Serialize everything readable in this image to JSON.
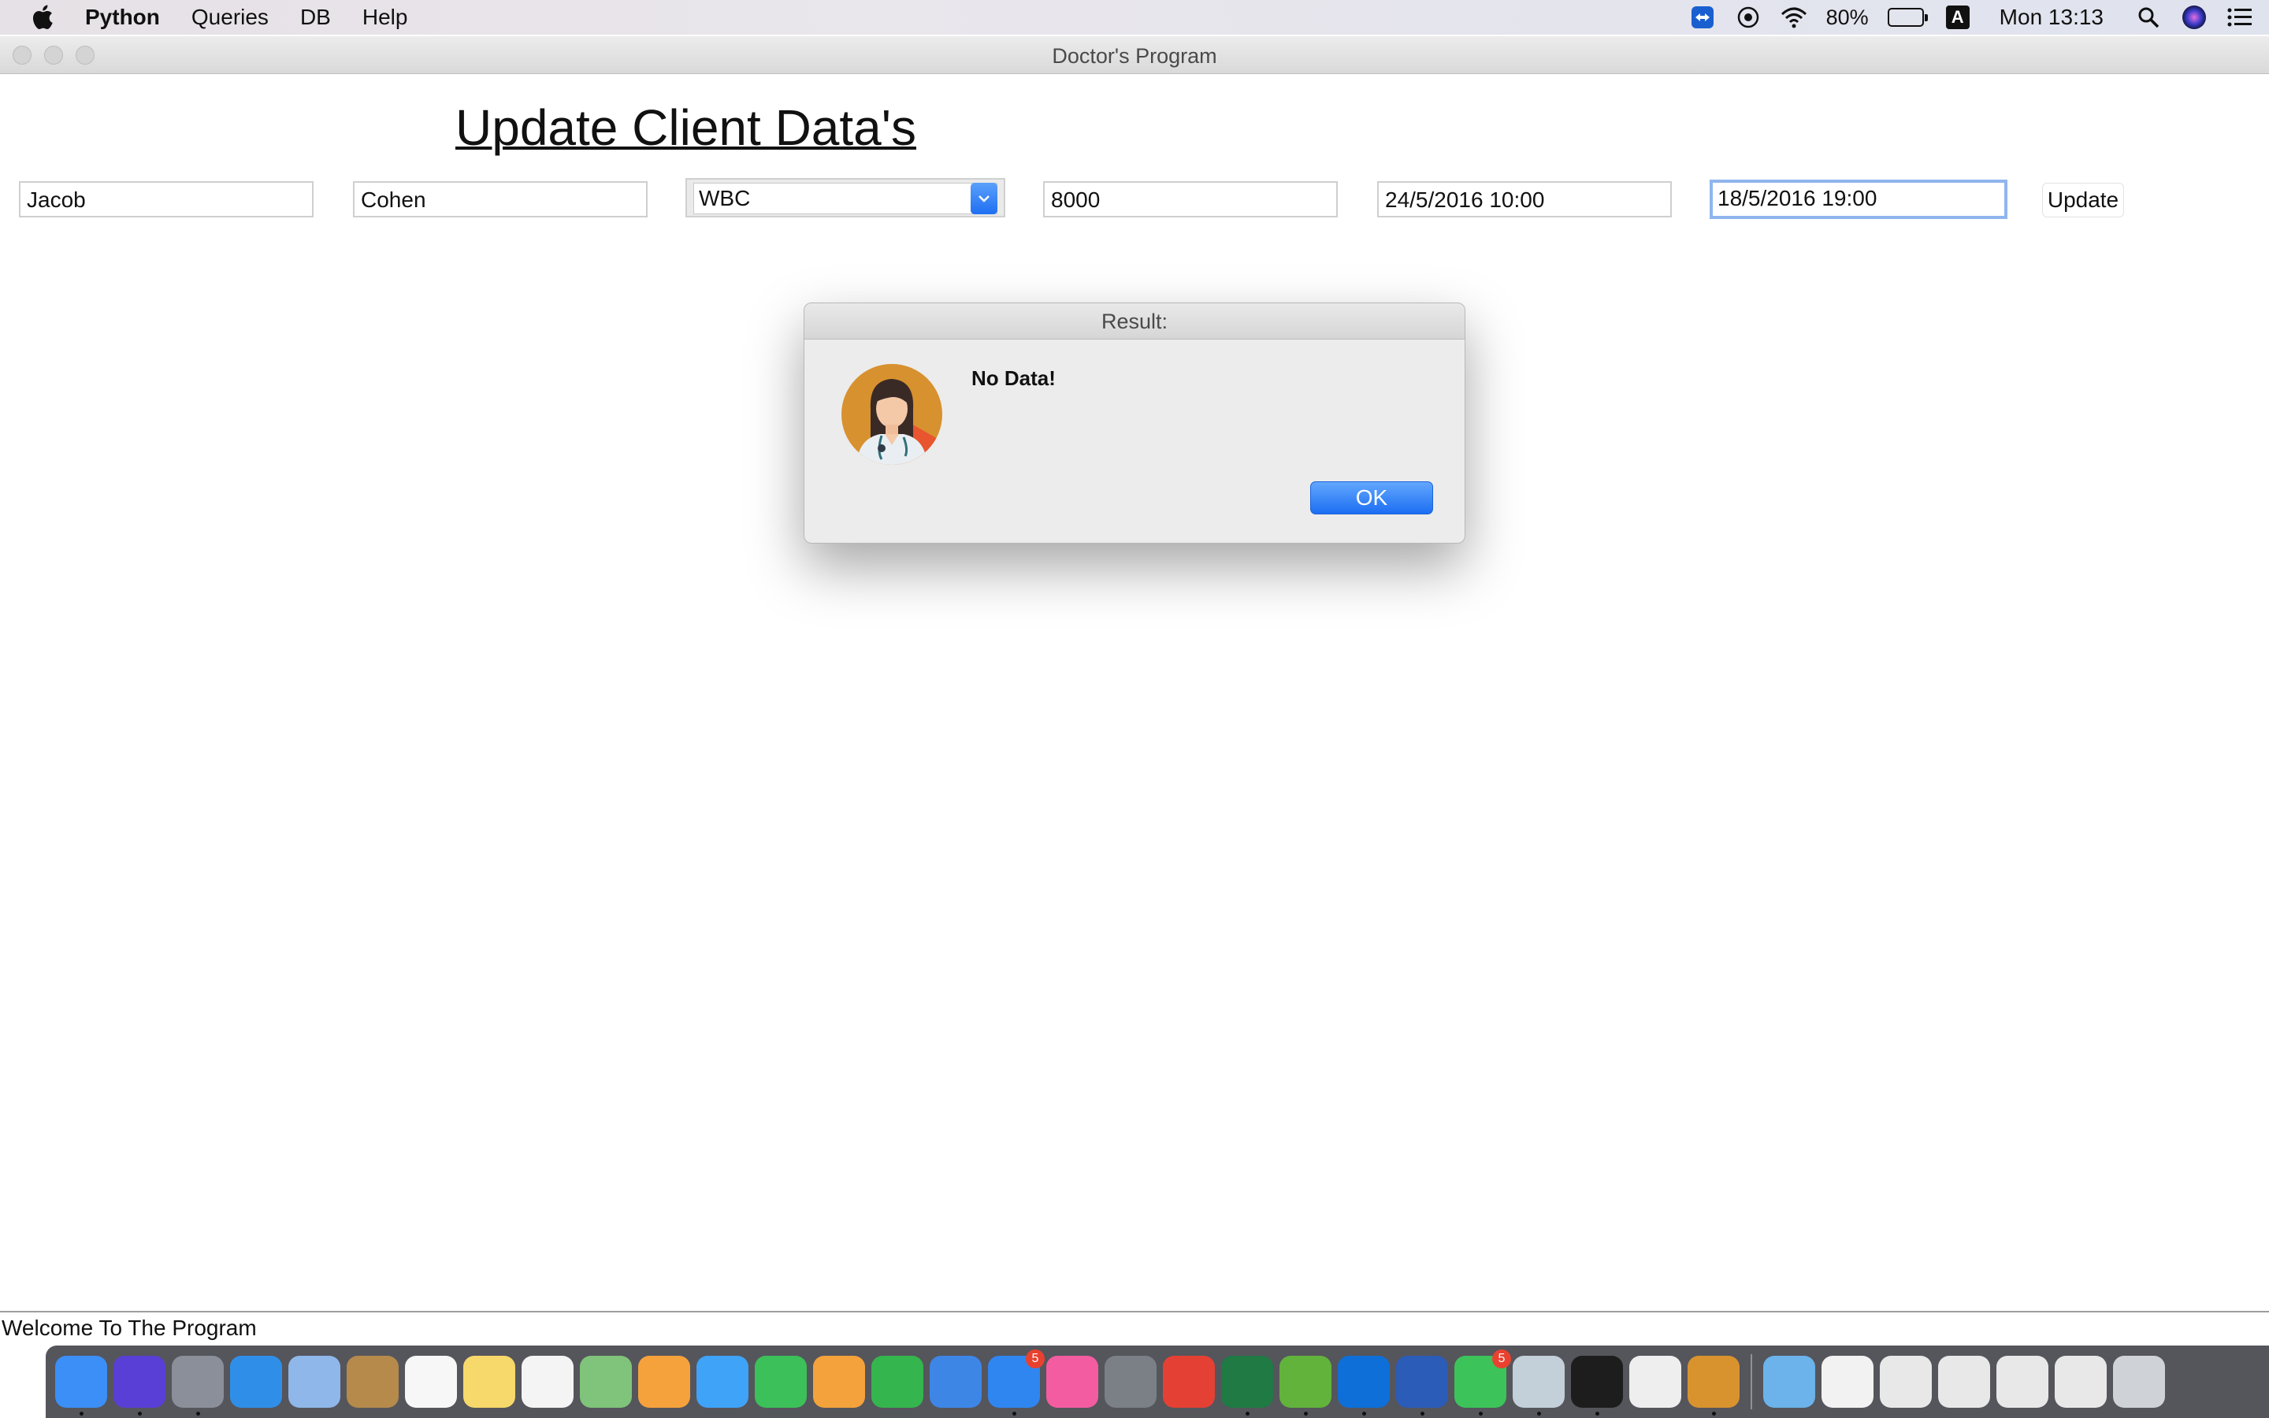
{
  "menubar": {
    "app_name": "Python",
    "menus": [
      "Queries",
      "DB",
      "Help"
    ],
    "battery_percent": "80%",
    "input_source": "A",
    "clock": "Mon 13:13"
  },
  "window": {
    "title": "Doctor's Program"
  },
  "form": {
    "heading": "Update Client Data's",
    "first_name": "Jacob",
    "last_name": "Cohen",
    "test_type": "WBC",
    "value": "8000",
    "date_from": "24/5/2016 10:00",
    "date_to": "18/5/2016 19:00",
    "update_label": "Update"
  },
  "dialog": {
    "title": "Result:",
    "message": "No Data!",
    "ok_label": "OK"
  },
  "status": {
    "text": "Welcome To The Program"
  },
  "dock": {
    "items": [
      {
        "name": "finder-icon",
        "color": "#3b8ff6"
      },
      {
        "name": "siri-icon",
        "color": "#5a3fd6"
      },
      {
        "name": "launchpad-icon",
        "color": "#8a8f99"
      },
      {
        "name": "safari-icon",
        "color": "#2f8fe8"
      },
      {
        "name": "mail-icon",
        "color": "#8fb7e9"
      },
      {
        "name": "contacts-icon",
        "color": "#b58a4b"
      },
      {
        "name": "calendar-icon",
        "color": "#f7f7f7"
      },
      {
        "name": "notes-icon",
        "color": "#f7d86a"
      },
      {
        "name": "reminders-icon",
        "color": "#f4f4f4"
      },
      {
        "name": "maps-icon",
        "color": "#7fc47a"
      },
      {
        "name": "photos-icon",
        "color": "#f6a23c"
      },
      {
        "name": "messages-icon",
        "color": "#3fa3f7"
      },
      {
        "name": "facetime-icon",
        "color": "#3cc05a"
      },
      {
        "name": "pages-icon",
        "color": "#f4a23b"
      },
      {
        "name": "numbers-icon",
        "color": "#35b54e"
      },
      {
        "name": "keynote-icon",
        "color": "#3d86e6"
      },
      {
        "name": "app-store-icon",
        "color": "#2f86f0",
        "badge": "5"
      },
      {
        "name": "itunes-icon",
        "color": "#f35ca0"
      },
      {
        "name": "system-preferences-icon",
        "color": "#7b7f86"
      },
      {
        "name": "chrome-icon",
        "color": "#e44134"
      },
      {
        "name": "excel-icon",
        "color": "#1f7a44"
      },
      {
        "name": "utorrent-icon",
        "color": "#62b33c"
      },
      {
        "name": "teamviewer-icon",
        "color": "#0e6fd8"
      },
      {
        "name": "word-icon",
        "color": "#2b5cb8"
      },
      {
        "name": "whatsapp-icon",
        "color": "#3cc35a",
        "badge": "5"
      },
      {
        "name": "preview-icon",
        "color": "#c3cfd9"
      },
      {
        "name": "pycharm-icon",
        "color": "#1d1d1d"
      },
      {
        "name": "textedit-icon",
        "color": "#eeeeee"
      },
      {
        "name": "doctor-app-icon",
        "color": "#d8932f"
      }
    ],
    "trailing": [
      {
        "name": "folder-icon",
        "color": "#6bb3ea"
      },
      {
        "name": "document-icon",
        "color": "#f2f2f2"
      },
      {
        "name": "screenshot-icon",
        "color": "#e8e8e8"
      },
      {
        "name": "screenshot-icon",
        "color": "#e8e8e8"
      },
      {
        "name": "screenshot-icon",
        "color": "#e8e8e8"
      },
      {
        "name": "screenshot-icon",
        "color": "#e8e8e8"
      },
      {
        "name": "trash-icon",
        "color": "#cfd3d8"
      }
    ]
  }
}
